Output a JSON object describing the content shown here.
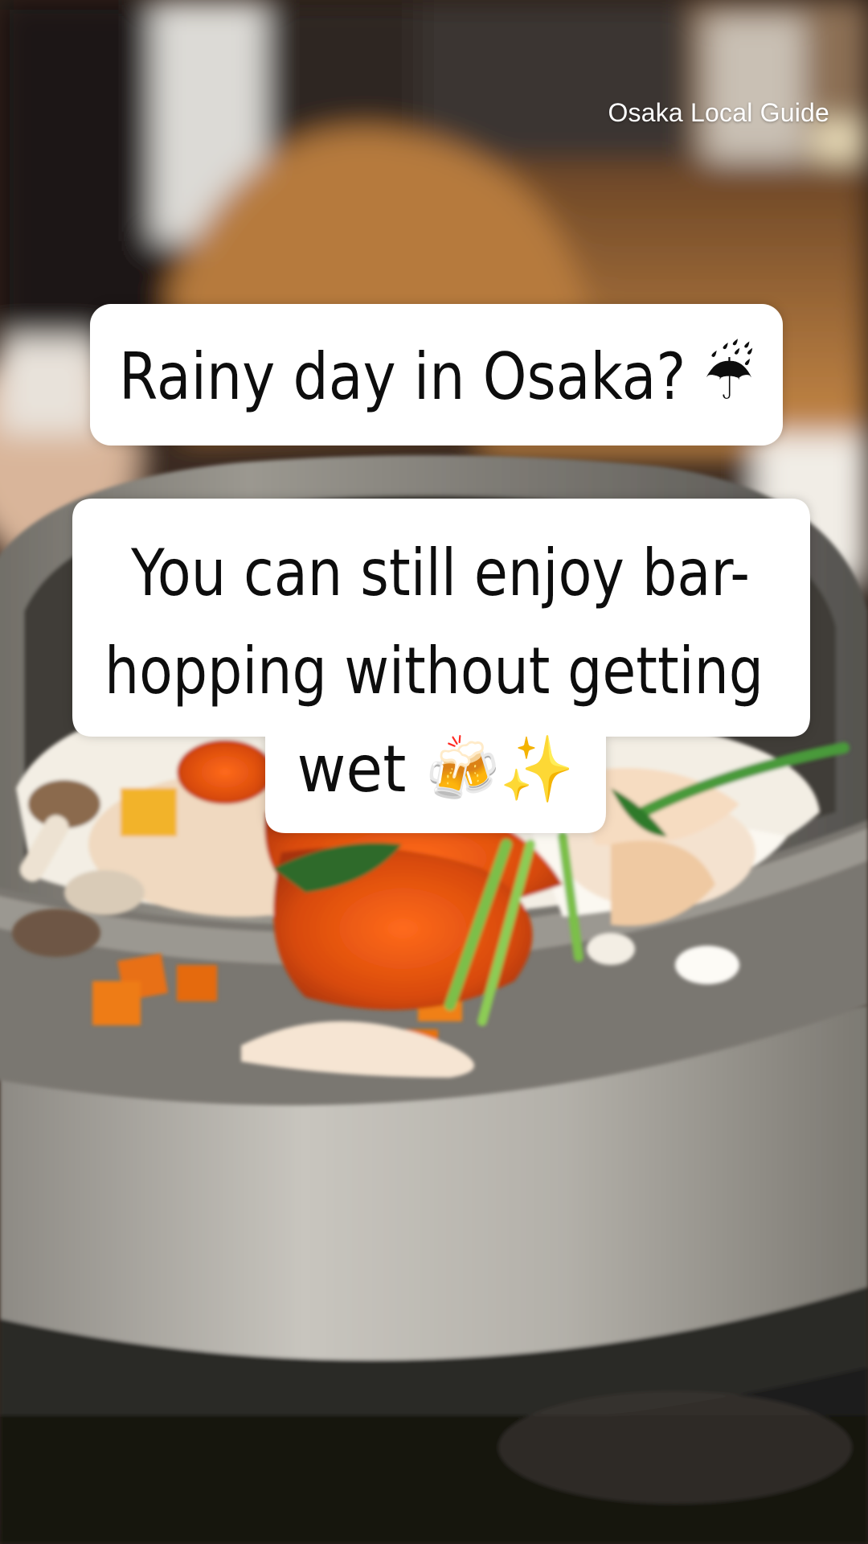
{
  "watermark": "Osaka Local Guide",
  "caption1": {
    "text": "Rainy day in Osaka? ☔"
  },
  "caption2": {
    "line1": "You can still enjoy bar-",
    "line2": "hopping without getting",
    "line3": "wet 🍻✨"
  },
  "colors": {
    "bubble": "#ffffff",
    "caption_text": "#111111",
    "watermark_text": "#ffffff"
  }
}
